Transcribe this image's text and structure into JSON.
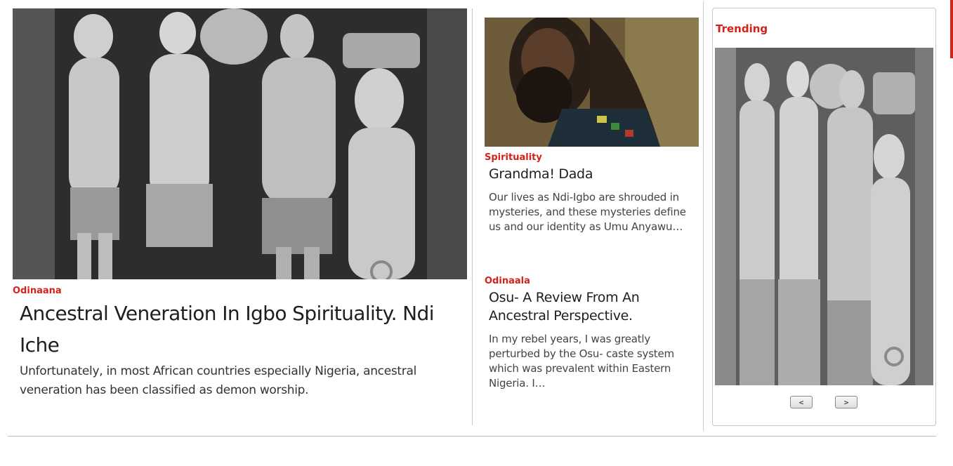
{
  "featured": {
    "category": "Odinaana",
    "title": "Ancestral Veneration In Igbo Spirituality. Ndi Iche",
    "excerpt": "Unfortunately, in most African countries especially Nigeria, ancestral veneration has been classified as demon worship."
  },
  "articles": [
    {
      "category": "Spirituality",
      "title": "Grandma! Dada",
      "excerpt": "Our lives as Ndi-Igbo are shrouded in mysteries, and these mysteries define us and our identity as Umu Anyawu…"
    },
    {
      "category": "Odinaala",
      "title": "Osu- A Review From An Ancestral Perspective.",
      "excerpt": "In my rebel years, I was greatly perturbed by the Osu- caste system which was prevalent within Eastern Nigeria. I…"
    }
  ],
  "trending": {
    "heading": "Trending",
    "prev_label": "<",
    "next_label": ">"
  },
  "colors": {
    "accent": "#d2221a",
    "divider": "#c8c8c8"
  }
}
